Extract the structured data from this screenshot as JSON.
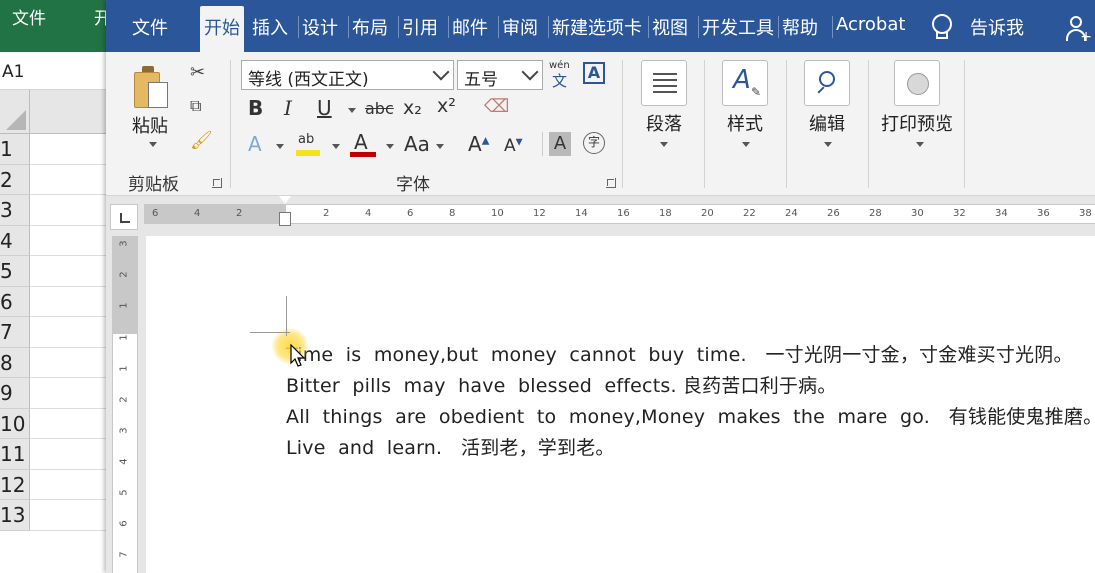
{
  "excel": {
    "tabs": [
      "文件",
      "开"
    ],
    "namebox": "A1",
    "rows": [
      "1",
      "2",
      "3",
      "4",
      "5",
      "6",
      "7",
      "8",
      "9",
      "10",
      "11",
      "12",
      "13"
    ]
  },
  "word": {
    "tabs": [
      {
        "label": "文件",
        "active": false
      },
      {
        "label": "开始",
        "active": true
      },
      {
        "label": "插入",
        "active": false
      },
      {
        "label": "设计",
        "active": false
      },
      {
        "label": "布局",
        "active": false
      },
      {
        "label": "引用",
        "active": false
      },
      {
        "label": "邮件",
        "active": false
      },
      {
        "label": "审阅",
        "active": false
      },
      {
        "label": "新建选项卡",
        "active": false
      },
      {
        "label": "视图",
        "active": false
      },
      {
        "label": "开发工具",
        "active": false
      },
      {
        "label": "帮助",
        "active": false
      },
      {
        "label": "Acrobat",
        "active": false
      }
    ],
    "tell_me": "告诉我",
    "ribbon": {
      "clipboard": {
        "paste": "粘贴",
        "group": "剪贴板"
      },
      "font": {
        "font_name": "等线 (西文正文)",
        "font_size": "五号",
        "phonetic": "wén",
        "phonetic_char": "文",
        "border_char": "A",
        "bold": "B",
        "italic": "I",
        "underline": "U",
        "strike": "abc",
        "sub": "x₂",
        "sup": "x²",
        "change_case": "Aa",
        "enc_char": "字",
        "group": "字体"
      },
      "paragraph": {
        "label": "段落"
      },
      "styles": {
        "label": "样式"
      },
      "editing": {
        "label": "编辑"
      },
      "print_preview": {
        "label": "打印预览"
      }
    },
    "ruler": {
      "left_numbers": [
        "6",
        "4",
        "2"
      ],
      "right_numbers": [
        "2",
        "4",
        "6",
        "8",
        "10",
        "12",
        "14",
        "16",
        "18",
        "20",
        "22",
        "24",
        "26",
        "28",
        "30",
        "32",
        "34",
        "36",
        "38"
      ],
      "v_margin_numbers": [
        "3",
        "2",
        "1"
      ],
      "v_numbers": [
        "1",
        "1",
        "2",
        "3",
        "4",
        "5",
        "6",
        "7"
      ]
    },
    "document": {
      "lines": [
        "Time  is  money,but  money  cannot  buy  time.   一寸光阴一寸金，寸金难买寸光阴。",
        "Bitter  pills  may  have  blessed  effects. 良药苦口利于病。",
        "All  things  are  obedient  to  money,Money  makes  the  mare  go.   有钱能使鬼推磨。",
        "Live  and  learn.   活到老，学到老。"
      ]
    }
  }
}
